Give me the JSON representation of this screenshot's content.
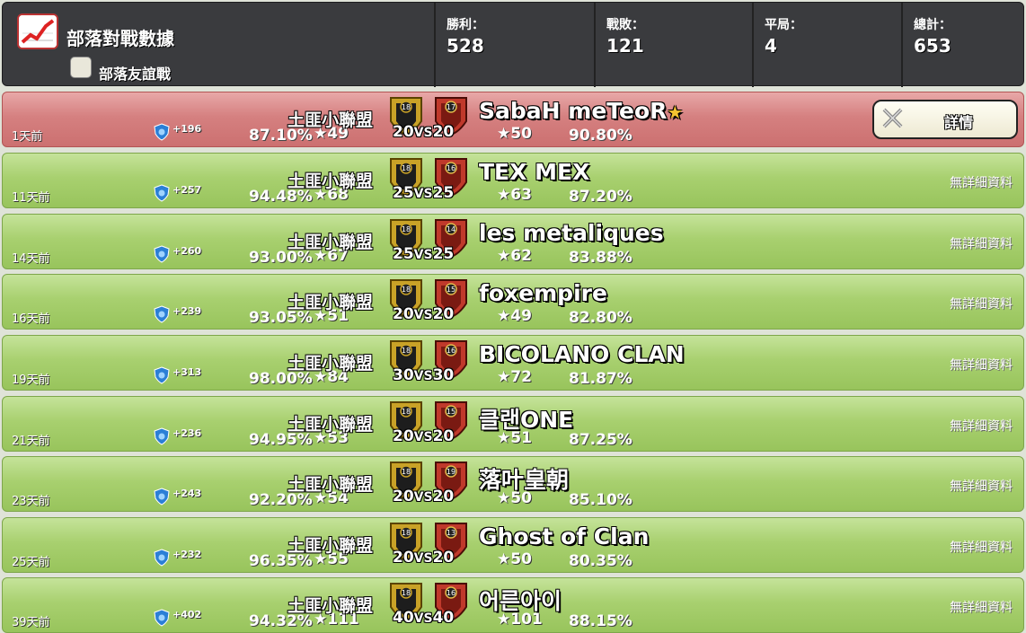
{
  "header": {
    "title": "部落對戰數據",
    "friendly_label": "部落友誼戰",
    "stats": [
      {
        "label": "勝利：",
        "value": "528"
      },
      {
        "label": "戰敗：",
        "value": "121"
      },
      {
        "label": "平局：",
        "value": "4"
      },
      {
        "label": "總計：",
        "value": "653"
      }
    ]
  },
  "my_clan": "土匪小聯盟",
  "vs": "VS",
  "details_label": "詳情",
  "no_details_label": "無詳細資料",
  "colors": {
    "win_row": "#a8d06f",
    "active_row": "#d58080",
    "header_bg": "#3a3b3e"
  },
  "wars": [
    {
      "ago": "1天前",
      "trophies": "+196",
      "my_pct": "87.10%",
      "my_stars": "49",
      "my_level": "18",
      "opp_level": "17",
      "size": "20",
      "opp_name": "SabaH meTeoR",
      "opp_stars": "50",
      "opp_pct": "90.80%",
      "has_details": true
    },
    {
      "ago": "11天前",
      "trophies": "+257",
      "my_pct": "94.48%",
      "my_stars": "68",
      "my_level": "18",
      "opp_level": "16",
      "size": "25",
      "opp_name": "TEX MEX",
      "opp_stars": "63",
      "opp_pct": "87.20%",
      "has_details": false
    },
    {
      "ago": "14天前",
      "trophies": "+260",
      "my_pct": "93.00%",
      "my_stars": "67",
      "my_level": "18",
      "opp_level": "14",
      "size": "25",
      "opp_name": "les metaliques",
      "opp_stars": "62",
      "opp_pct": "83.88%",
      "has_details": false
    },
    {
      "ago": "16天前",
      "trophies": "+239",
      "my_pct": "93.05%",
      "my_stars": "51",
      "my_level": "18",
      "opp_level": "15",
      "size": "20",
      "opp_name": "foxempire",
      "opp_stars": "49",
      "opp_pct": "82.80%",
      "has_details": false
    },
    {
      "ago": "19天前",
      "trophies": "+313",
      "my_pct": "98.00%",
      "my_stars": "84",
      "my_level": "18",
      "opp_level": "16",
      "size": "30",
      "opp_name": "BICOLANO CLAN",
      "opp_stars": "72",
      "opp_pct": "81.87%",
      "has_details": false
    },
    {
      "ago": "21天前",
      "trophies": "+236",
      "my_pct": "94.95%",
      "my_stars": "53",
      "my_level": "18",
      "opp_level": "15",
      "size": "20",
      "opp_name": "클랜ONE",
      "opp_stars": "51",
      "opp_pct": "87.25%",
      "has_details": false
    },
    {
      "ago": "23天前",
      "trophies": "+243",
      "my_pct": "92.20%",
      "my_stars": "54",
      "my_level": "18",
      "opp_level": "19",
      "size": "20",
      "opp_name": "落叶皇朝",
      "opp_stars": "50",
      "opp_pct": "85.10%",
      "has_details": false
    },
    {
      "ago": "25天前",
      "trophies": "+232",
      "my_pct": "96.35%",
      "my_stars": "55",
      "my_level": "18",
      "opp_level": "13",
      "size": "20",
      "opp_name": "Ghost of Clan",
      "opp_stars": "50",
      "opp_pct": "80.35%",
      "has_details": false
    },
    {
      "ago": "39天前",
      "trophies": "+402",
      "my_pct": "94.32%",
      "my_stars": "111",
      "my_level": "18",
      "opp_level": "16",
      "size": "40",
      "opp_name": "어른아이",
      "opp_stars": "101",
      "opp_pct": "88.15%",
      "has_details": false
    }
  ]
}
